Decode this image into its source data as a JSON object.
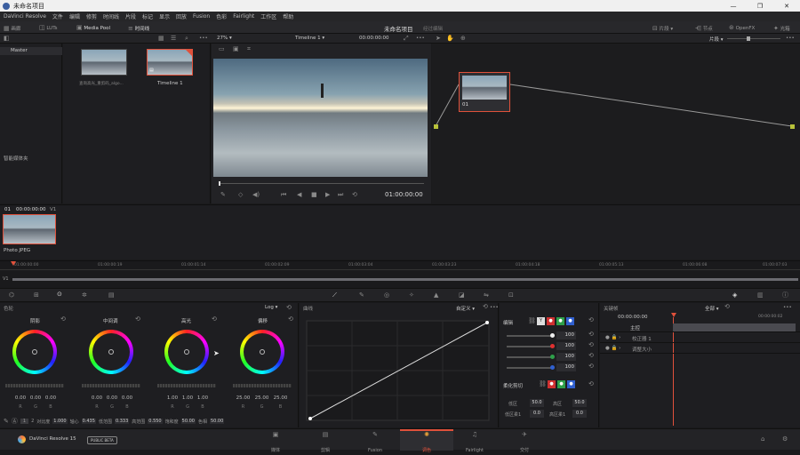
{
  "window": {
    "title": "未命名项目",
    "controls": {
      "min": "—",
      "max": "❐",
      "close": "✕"
    }
  },
  "menu": [
    "DaVinci Resolve",
    "文件",
    "编辑",
    "修剪",
    "时间线",
    "片段",
    "标记",
    "显示",
    "回放",
    "Fusion",
    "色彩",
    "Fairlight",
    "工作区",
    "帮助"
  ],
  "toolbar": {
    "left_tabs": [
      "画廊",
      "LUTs",
      "Media Pool",
      "时间线"
    ],
    "project_name": "未命名项目",
    "status": "经过编辑",
    "right": [
      "片段",
      "节点",
      "OpenFX",
      "光箱"
    ]
  },
  "subbar": {
    "zoom": "27%",
    "timeline": "Timeline 1",
    "timecode": "00:00:00:00",
    "clip_mode": "片段"
  },
  "media": {
    "root": "Master",
    "smart_bins": "智能媒体夹",
    "thumbs": [
      {
        "label": "查询高光_重剪码_algo..."
      },
      {
        "label": "Timeline 1"
      }
    ]
  },
  "viewer": {
    "timecode": "01:00:00:00"
  },
  "node": {
    "label": "01"
  },
  "clips": {
    "header_num": "01",
    "header_tc": "00:00:00:00",
    "track": "V1",
    "clip_label": "Photo JPEG"
  },
  "ruler": [
    "01:00:00:00",
    "01:00:00:19",
    "01:00:01:14",
    "01:00:02:09",
    "01:00:03:04",
    "01:00:03:23",
    "01:00:04:18",
    "01:00:05:13",
    "01:00:06:08",
    "01:00:07:03"
  ],
  "track_label": "V1",
  "color": {
    "panel_title": "色轮",
    "log_label": "Log",
    "wheels": [
      {
        "label": "阴影",
        "vals": [
          "0.00",
          "0.00",
          "0.00"
        ]
      },
      {
        "label": "中间调",
        "vals": [
          "0.00",
          "0.00",
          "0.00"
        ]
      },
      {
        "label": "高光",
        "vals": [
          "1.00",
          "1.00",
          "1.00"
        ]
      },
      {
        "label": "偏移",
        "vals": [
          "25.00",
          "25.00",
          "25.00"
        ]
      }
    ],
    "rgb": [
      "R",
      "G",
      "B"
    ],
    "bottom": {
      "page1": "1",
      "page2": "2",
      "contrast_label": "对比度",
      "contrast": "1.000",
      "pivot_label": "轴心",
      "pivot": "0.435",
      "lowrange_label": "低范围",
      "lowrange": "0.333",
      "highrange_label": "高范围",
      "highrange": "0.550",
      "sat_label": "饱和度",
      "sat": "50.00",
      "hue_label": "色相",
      "hue": "50.00"
    }
  },
  "curves": {
    "title": "曲线",
    "mode": "自定义"
  },
  "edit": {
    "title": "编辑",
    "chan": [
      "Y",
      "R",
      "G",
      "B"
    ],
    "vals": [
      "100",
      "100",
      "100",
      "100"
    ],
    "soft_title": "柔化剪切",
    "soft": [
      {
        "label": "低区",
        "val": "50.0"
      },
      {
        "label": "高区",
        "val": "50.0"
      },
      {
        "label": "低区柔1",
        "val": "0.0"
      },
      {
        "label": "高区柔1",
        "val": "0.0"
      }
    ]
  },
  "keyframes": {
    "title": "关键帧",
    "mode": "全部",
    "tc1": "00:00:00:00",
    "tc2": "00:00:00:02",
    "rows": [
      "主控",
      "校正器 1",
      "调整大小"
    ]
  },
  "footer": {
    "app": "DaVinci Resolve 15",
    "badge": "PUBLIC BETA",
    "pages": [
      "媒体",
      "剪辑",
      "Fusion",
      "调色",
      "Fairlight",
      "交付"
    ],
    "active_page": "调色"
  }
}
